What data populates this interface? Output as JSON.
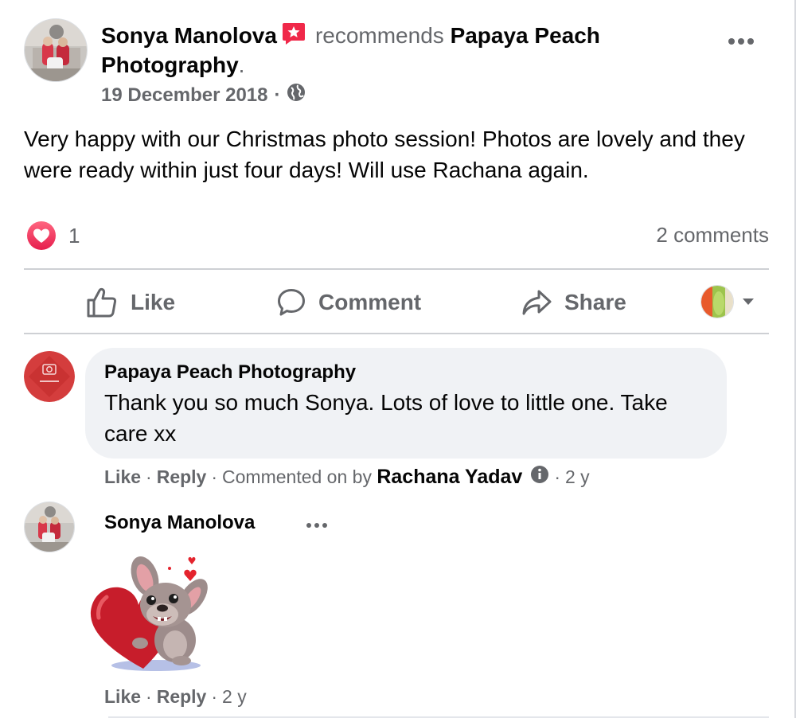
{
  "post": {
    "author": "Sonya Manolova",
    "verb": "recommends",
    "page_name": "Papaya Peach Photography",
    "period": ".",
    "date": "19 December 2018",
    "dot": "·",
    "privacy_icon": "globe-icon",
    "body": "Very happy with our Christmas photo session! Photos are lovely and they were ready within just four days! Will use Rachana again.",
    "reaction_icon": "heart-icon",
    "reaction_count": "1",
    "comments_count": "2 comments"
  },
  "actions": {
    "like": "Like",
    "comment": "Comment",
    "share": "Share"
  },
  "comments": [
    {
      "author": "Papaya Peach Photography",
      "text": "Thank you so much Sonya. Lots of love to little one. Take care xx",
      "like": "Like",
      "reply": "Reply",
      "commented_on_by": "Commented on by",
      "by_name": "Rachana Yadav",
      "time": "2 y",
      "dot": "·"
    },
    {
      "author": "Sonya Manolova",
      "sticker": "heart-dog-sticker",
      "like": "Like",
      "reply": "Reply",
      "time": "2 y",
      "dot": "·"
    }
  ],
  "colors": {
    "text": "#050505",
    "secondary": "#65676b",
    "bubble": "#f0f2f5",
    "divider": "#ced0d4",
    "heart": "#e61e4d",
    "badge_pink": "#f02849"
  }
}
